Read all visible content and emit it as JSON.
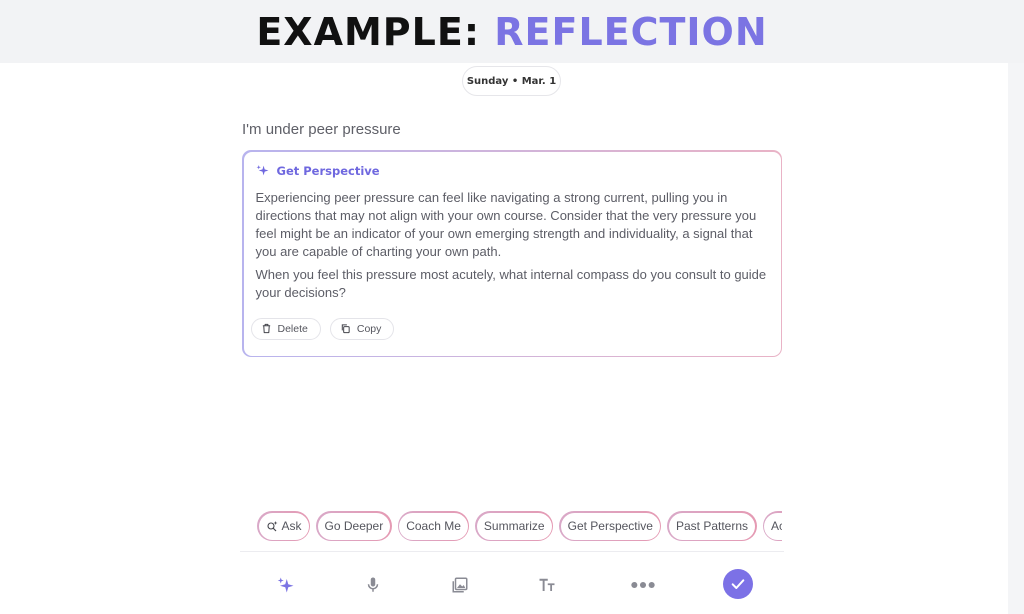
{
  "banner": {
    "title_prefix": "EXAMPLE: ",
    "title_highlight": "REFLECTION"
  },
  "date_pill": {
    "label": "Sunday • Mar. 1"
  },
  "entry": {
    "text": "I'm under peer pressure"
  },
  "perspective_card": {
    "title": "Get Perspective",
    "paragraphs": [
      "Experiencing peer pressure can feel like navigating a strong current, pulling you in directions that may not align with your own course. Consider that the very pressure you feel might be an indicator of your own emerging strength and individuality, a signal that you are capable of charting your own path.",
      "When you feel this pressure most acutely, what internal compass do you consult to guide your decisions?"
    ],
    "actions": {
      "delete_label": "Delete",
      "copy_label": "Copy"
    }
  },
  "chips": [
    {
      "label": "Ask",
      "icon": "ask-sparkle-search-icon"
    },
    {
      "label": "Go Deeper"
    },
    {
      "label": "Coach Me"
    },
    {
      "label": "Summarize"
    },
    {
      "label": "Get Perspective"
    },
    {
      "label": "Past Patterns"
    },
    {
      "label": "Action"
    }
  ],
  "toolbar": {
    "icons": [
      "sparkles-icon",
      "microphone-icon",
      "gallery-icon",
      "text-format-icon",
      "more-icon",
      "checkmark-icon"
    ]
  },
  "colors": {
    "accent": "#7b74e3",
    "card_gradient": [
      "#b8b4ee",
      "#e9b3c6"
    ],
    "chip_gradient": [
      "#d9a9c8",
      "#e59ab3"
    ]
  }
}
